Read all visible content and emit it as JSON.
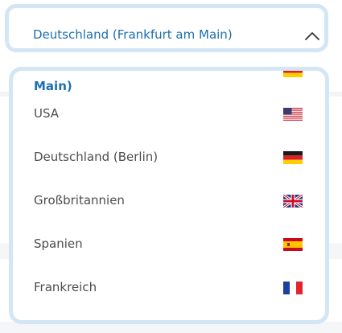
{
  "select": {
    "value": "Deutschland (Frankfurt am Main)",
    "icon": "chevron-up-icon"
  },
  "options": [
    {
      "label": "Main)",
      "flag": "germany-flag-icon",
      "selected": true
    },
    {
      "label": "USA",
      "flag": "usa-flag-icon"
    },
    {
      "label": "Deutschland (Berlin)",
      "flag": "germany-flag-icon"
    },
    {
      "label": "Großbritannien",
      "flag": "uk-flag-icon"
    },
    {
      "label": "Spanien",
      "flag": "spain-flag-icon"
    },
    {
      "label": "Frankreich",
      "flag": "france-flag-icon"
    }
  ],
  "colors": {
    "accent": "#1d6fae",
    "border": "#d3e6f5",
    "text": "#4d4d4d"
  }
}
